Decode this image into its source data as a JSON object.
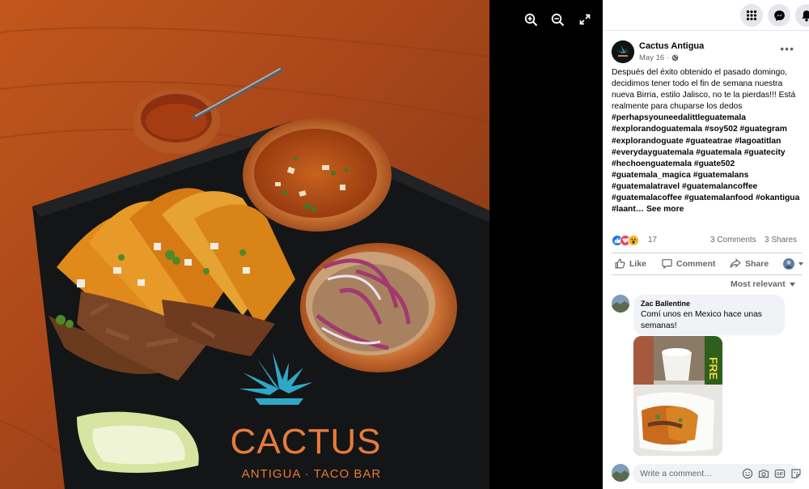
{
  "viewer": {
    "photo_logo_name": "CACTUS",
    "photo_logo_tagline": "ANTIGUA · TACO BAR",
    "tools": [
      "zoom-in-icon",
      "zoom-out-icon",
      "fullscreen-icon"
    ]
  },
  "topbar": {
    "icons": [
      "menu-grid-icon",
      "messenger-icon",
      "notifications-icon"
    ],
    "background": "#e4e6eb"
  },
  "post": {
    "page_name": "Cactus Antigua",
    "date": "May 16 ·",
    "audience_icon": "globe-icon",
    "text_intro": "Después del éxito obtenido el pasado domingo, decidimos tener todo el fin de semana nuestra nueva Birria, estilo Jalisco, no te la pierdas!!! Está realmente para chuparse los dedos",
    "hashtags": "#perhapsyouneedalittleguatemala #explorandoguatemala #soy502 #guategram #explorandoguate #guateatrae #lagoatitlan #everydayguatemala #guatemala #guatecity #hechoenguatemala #guate502 #guatemala_magica #guatemalans #guatemalatravel #guatemalancoffee #guatemalacoffee #guatemalanfood #okantigua #laant…",
    "see_more": "See more",
    "reaction_count": "17",
    "comments_count": "3 Comments",
    "shares_count": "3 Shares",
    "actions": {
      "like": "Like",
      "comment": "Comment",
      "share": "Share"
    },
    "sort_label": "Most relevant"
  },
  "comment": {
    "author": "Zac Ballentine",
    "text": "Comí unos en Mexico hace unas semanas!"
  },
  "composer": {
    "placeholder": "Write a comment…",
    "icons": [
      "emoji-icon",
      "camera-icon",
      "gif-icon",
      "sticker-icon"
    ]
  },
  "colors": {
    "facebook_blue": "#1877f2",
    "text_primary": "#050505",
    "text_secondary": "#65676b",
    "bubble": "#f0f2f5"
  }
}
